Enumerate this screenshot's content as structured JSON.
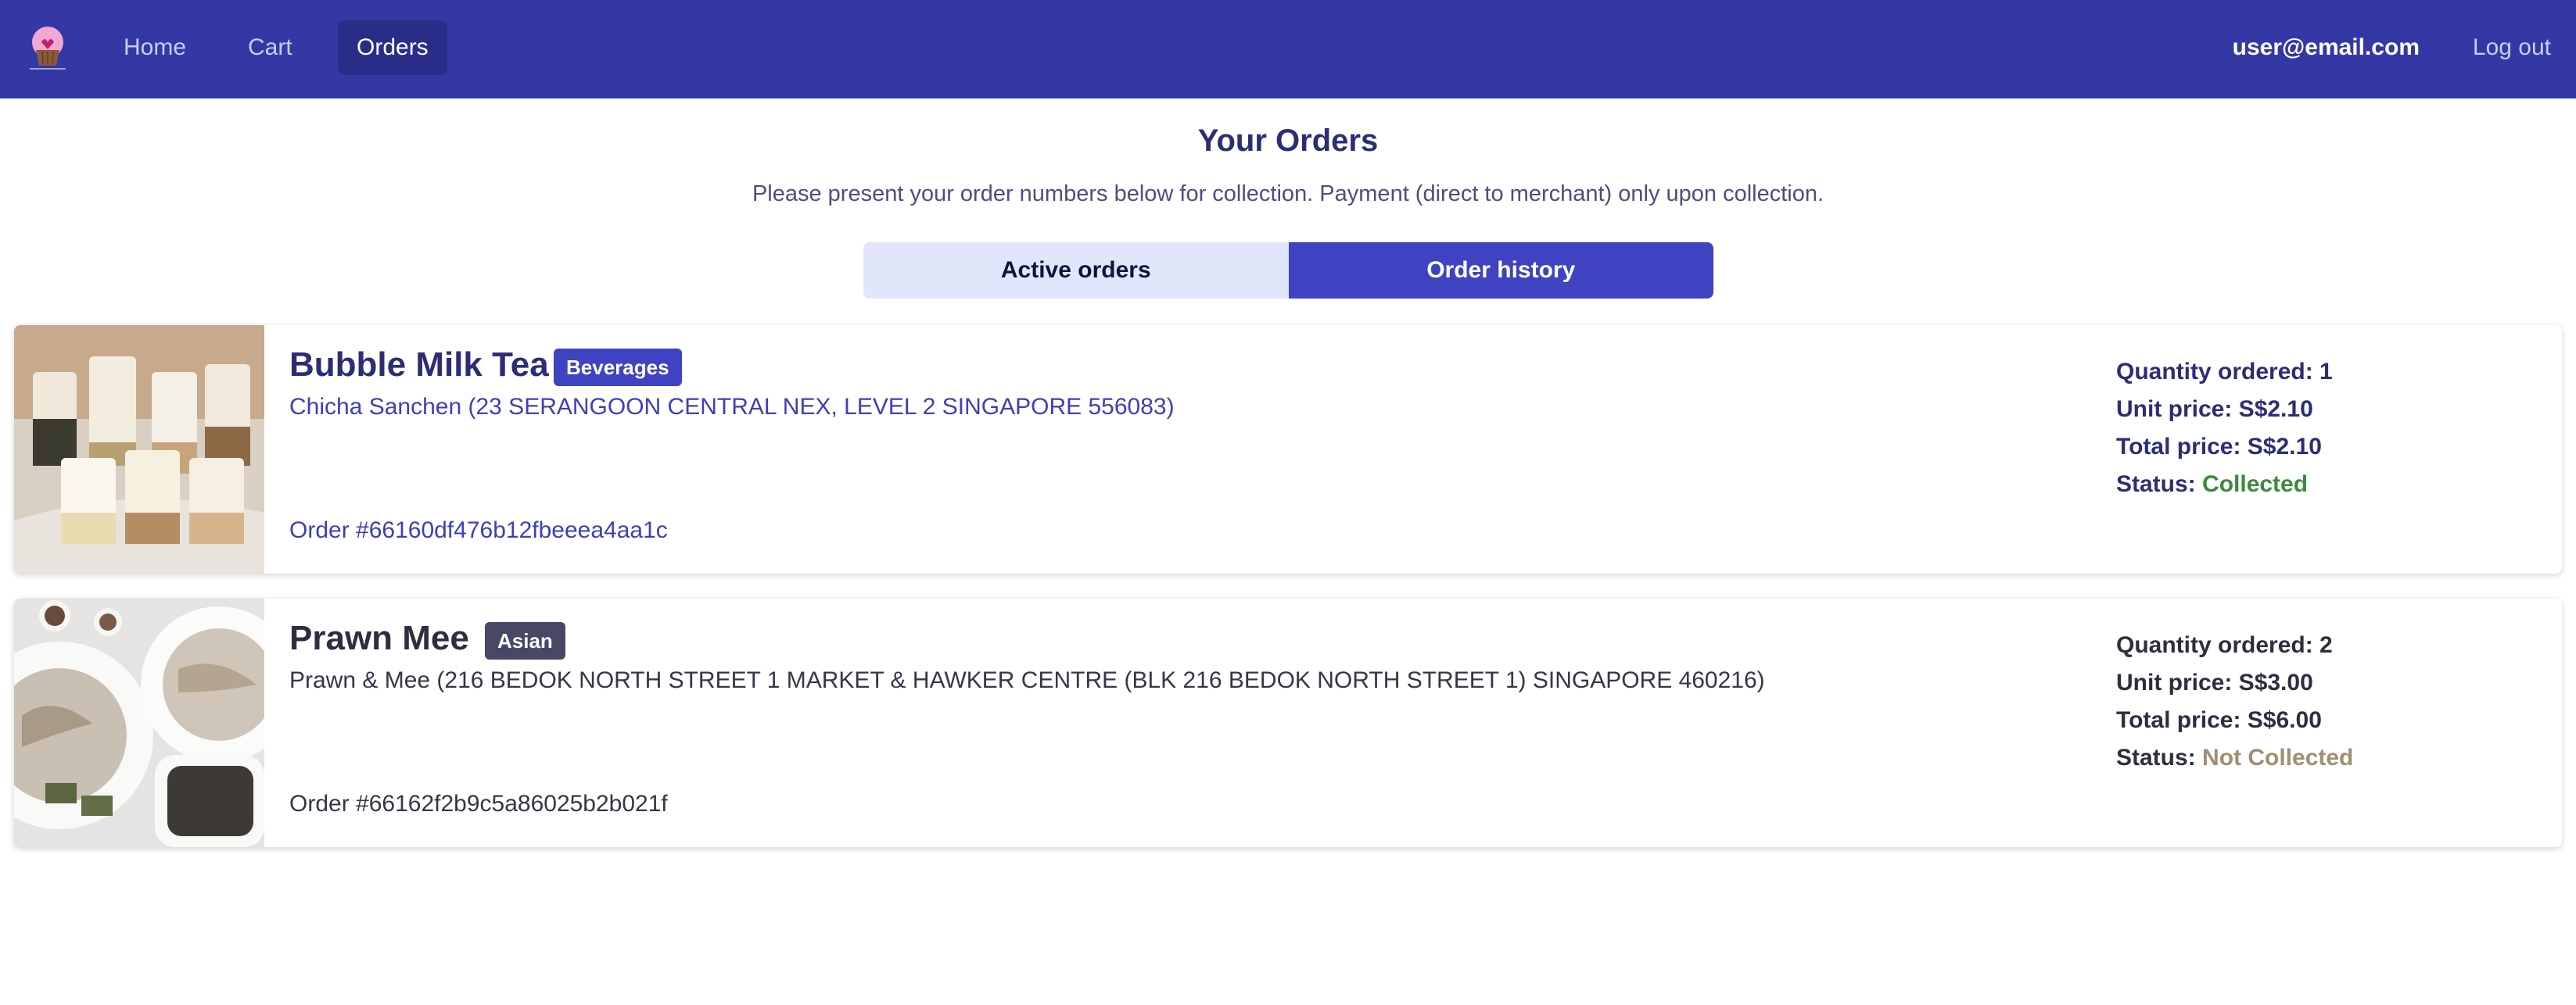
{
  "navbar": {
    "logo_icon": "cupcake-heart-logo-icon",
    "links": [
      {
        "label": "Home"
      },
      {
        "label": "Cart"
      },
      {
        "label": "Orders"
      }
    ],
    "active": "Orders",
    "user_email": "user@email.com",
    "logout_label": "Log out"
  },
  "header": {
    "title": "Your Orders",
    "subtitle": "Please present your order numbers below for collection. Payment (direct to merchant) only upon collection."
  },
  "tabs": [
    {
      "label": "Active orders"
    },
    {
      "label": "Order history"
    }
  ],
  "orders": [
    {
      "name": "Bubble Milk Tea",
      "category": "Beverages",
      "merchant": "Chicha Sanchen (23 SERANGOON CENTRAL NEX, LEVEL 2 SINGAPORE 556083)",
      "order_number": "Order #66160df476b12fbeeea4aa1c",
      "quantity_label": "Quantity ordered: 1",
      "unit_price_label": "Unit price: S$2.10",
      "total_price_label": "Total price: S$2.10",
      "status_label": "Status:",
      "status": "Collected",
      "image": "bubble-tea-cups-photo"
    },
    {
      "name": "Prawn Mee",
      "category": "Asian",
      "merchant": "Prawn & Mee (216 BEDOK NORTH STREET 1 MARKET & HAWKER CENTRE (BLK 216 BEDOK NORTH STREET 1) SINGAPORE 460216)",
      "order_number": "Order #66162f2b9c5a86025b2b021f",
      "quantity_label": "Quantity ordered: 2",
      "unit_price_label": "Unit price: S$3.00",
      "total_price_label": "Total price: S$6.00",
      "status_label": "Status:",
      "status": "Not Collected",
      "image": "prawn-noodle-bowls-photo"
    }
  ],
  "colors": {
    "navbar": "#3438a4",
    "accent": "#3f42c1",
    "collected": "#3c8a3e",
    "not_collected": "#a18e73"
  }
}
